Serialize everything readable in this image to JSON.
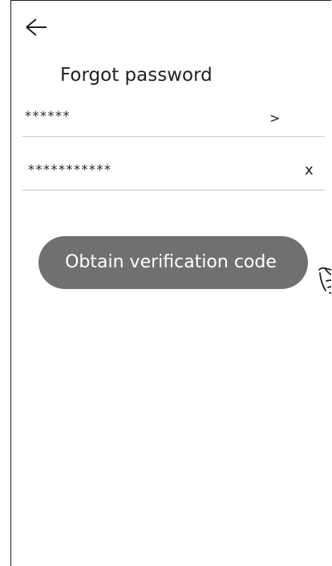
{
  "header": {
    "back_icon": "arrow-left-icon",
    "title": "Forgot password"
  },
  "form": {
    "account": {
      "value": "******",
      "action": ">"
    },
    "password": {
      "value": "***********",
      "action": "x"
    }
  },
  "actions": {
    "obtain_code_label": "Obtain verification code",
    "pointer_icon": "pointing-hand-icon"
  },
  "colors": {
    "button_background": "#707070",
    "button_text": "#ffffff",
    "text": "#231f20",
    "divider": "#c9c9c9"
  }
}
